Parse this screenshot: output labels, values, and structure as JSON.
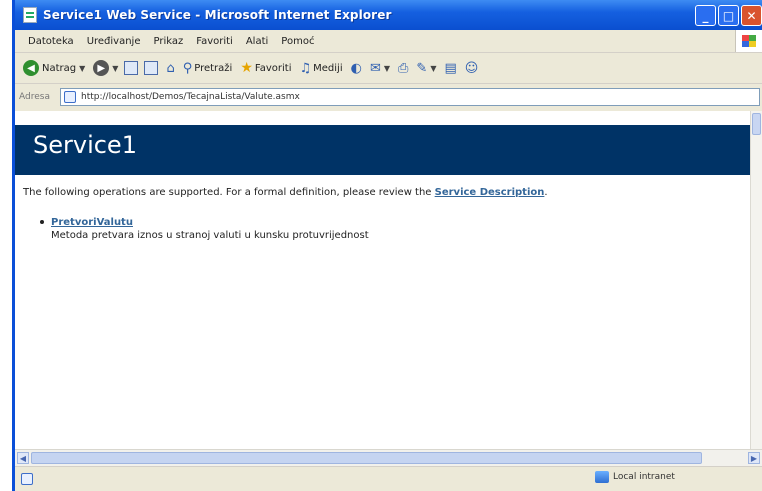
{
  "window": {
    "title": "Service1 Web Service - Microsoft Internet Explorer",
    "buttons": {
      "minimize": "_",
      "maximize": "□",
      "close": "✕"
    }
  },
  "menu": {
    "items": [
      "Datoteka",
      "Uređivanje",
      "Prikaz",
      "Favoriti",
      "Alati",
      "Pomoć"
    ]
  },
  "toolbar": {
    "back_label": "Natrag",
    "search_label": "Pretraži",
    "favorites_label": "Favoriti",
    "media_label": "Mediji"
  },
  "address": {
    "label": "Adresa",
    "url": "http://localhost/Demos/TecajnaLista/Valute.asmx"
  },
  "page": {
    "heading": "Service1",
    "intro_text": "The following operations are supported. For a formal definition, please review the ",
    "service_description_link": "Service Description",
    "intro_end": ".",
    "operations": [
      {
        "name": "PretvoriValutu",
        "description": "Metoda pretvara iznos u stranoj valuti u kunsku protuvrijednost"
      }
    ]
  },
  "status": {
    "zone_label": "Local intranet"
  },
  "colors": {
    "title_bar": "#0a4fd8",
    "heading_bg": "#003366",
    "link": "#336699"
  }
}
